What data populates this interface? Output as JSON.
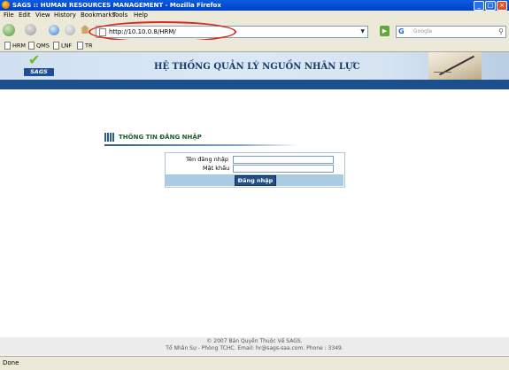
{
  "window": {
    "title": "SAGS :: HUMAN RESOURCES MANAGEMENT - Mozilla Firefox"
  },
  "menu": [
    "File",
    "Edit",
    "View",
    "History",
    "Bookmarks",
    "Tools",
    "Help"
  ],
  "address": {
    "url": "http://10.10.0.8/HRM/"
  },
  "search": {
    "placeholder": "Google"
  },
  "bookmarks": [
    "HRM",
    "QMS",
    "LNF",
    "TR"
  ],
  "banner": {
    "logo_text": "SAGS",
    "title": "HỆ THỐNG QUẢN LÝ NGUỒN NHÂN LỰC"
  },
  "login": {
    "section_title": "THÔNG TIN ĐĂNG NHẬP",
    "username_label": "Tên đăng nhập",
    "password_label": "Mật khẩu",
    "username_value": "",
    "password_value": "",
    "submit_label": "Đăng nhập"
  },
  "footer": {
    "line1": "© 2007 Bản Quyền Thuộc Về SAGS.",
    "line2": "Tổ Nhân Sự - Phòng TCHC. Email: hr@sags-saa.com. Phone : 3349."
  },
  "status": {
    "text": "Done"
  },
  "colors": {
    "accent_red": "#d9281c",
    "banner_dark": "#1d4f8c",
    "title_blue": "#17396e"
  }
}
